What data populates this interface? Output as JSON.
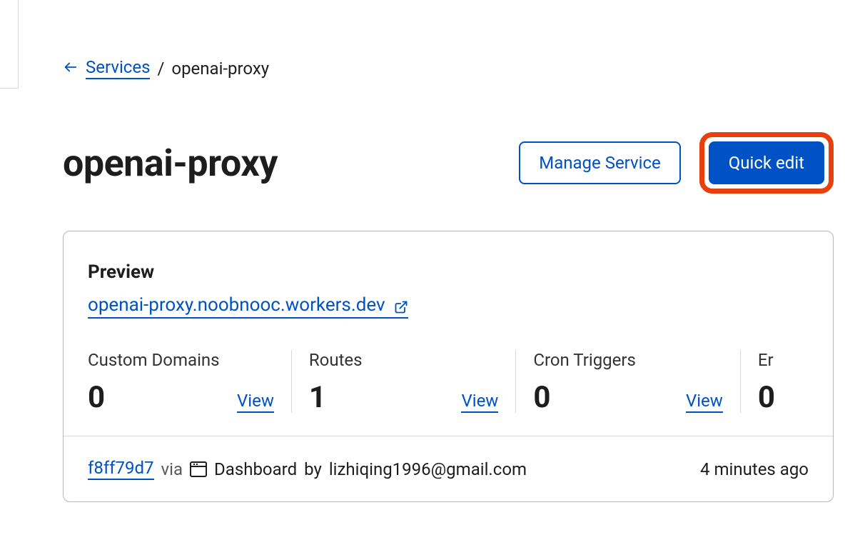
{
  "breadcrumb": {
    "parent": "Services",
    "separator": "/",
    "current": "openai-proxy"
  },
  "header": {
    "title": "openai-proxy",
    "manage_label": "Manage Service",
    "quick_edit_label": "Quick edit"
  },
  "preview": {
    "label": "Preview",
    "url": "openai-proxy.noobnooc.workers.dev"
  },
  "stats": [
    {
      "label": "Custom Domains",
      "value": "0",
      "action": "View"
    },
    {
      "label": "Routes",
      "value": "1",
      "action": "View"
    },
    {
      "label": "Cron Triggers",
      "value": "0",
      "action": "View"
    },
    {
      "label": "Er",
      "value": "0",
      "action": ""
    }
  ],
  "footer": {
    "commit": "f8ff79d7",
    "via": "via",
    "source": "Dashboard",
    "by": "by",
    "author": "lizhiqing1996@gmail.com",
    "time": "4 minutes ago"
  }
}
